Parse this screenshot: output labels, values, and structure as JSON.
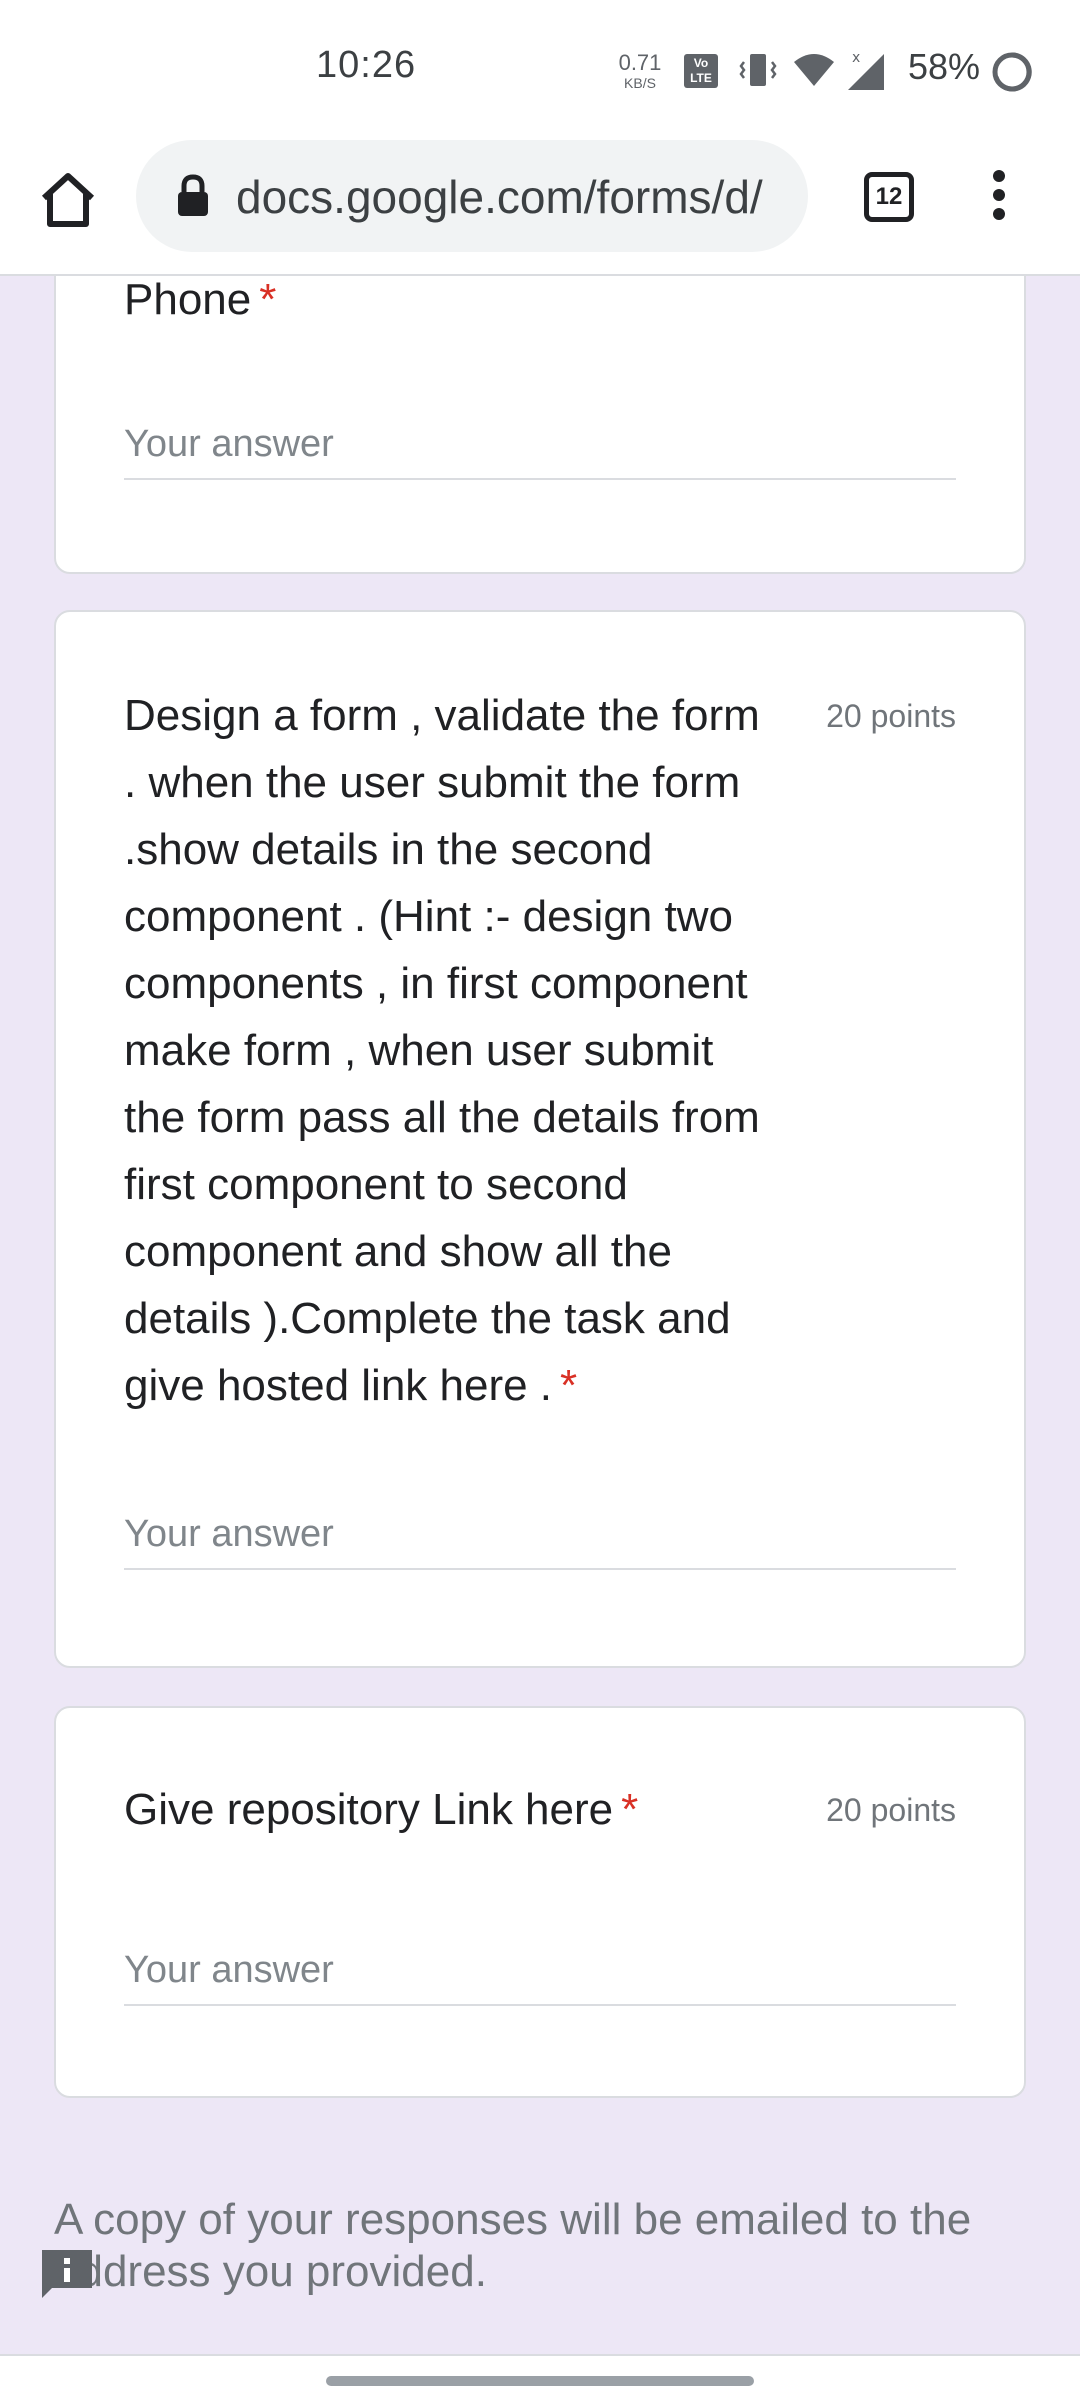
{
  "status_bar": {
    "time": "10:26",
    "net_speed_value": "0.71",
    "net_speed_unit": "KB/S",
    "volte_label": "Vo LTE",
    "battery_percent": "58%",
    "icons": [
      "vibrate-icon",
      "wifi-icon",
      "signal-icon",
      "battery-icon"
    ]
  },
  "browser": {
    "url": "docs.google.com/forms/d/",
    "tab_count": "12",
    "icons": [
      "home-icon",
      "lock-icon",
      "tabs-icon",
      "more-vert-icon"
    ]
  },
  "form": {
    "questions": [
      {
        "title": "Phone",
        "required_mark": "*",
        "points": "",
        "placeholder": "Your answer"
      },
      {
        "title_lines": [
          "Design a form , validate the form",
          ". when the user submit the form",
          ".show details in the second",
          "component . (Hint :- design two",
          "components , in first component",
          "make form , when user submit",
          "the form pass all the details from",
          "first component to second",
          "component and show all the",
          "details ).Complete the task and",
          "give hosted link here ."
        ],
        "required_mark": "*",
        "points": "20 points",
        "placeholder": "Your answer"
      },
      {
        "title": "Give repository Link here",
        "required_mark": "*",
        "points": "20 points",
        "placeholder": "Your answer"
      }
    ],
    "footer_note": "A copy of your responses will be emailed to the address you provided."
  },
  "colors": {
    "page_background": "#ede7f6",
    "required": "#d93025",
    "card_border": "#dadce0"
  }
}
